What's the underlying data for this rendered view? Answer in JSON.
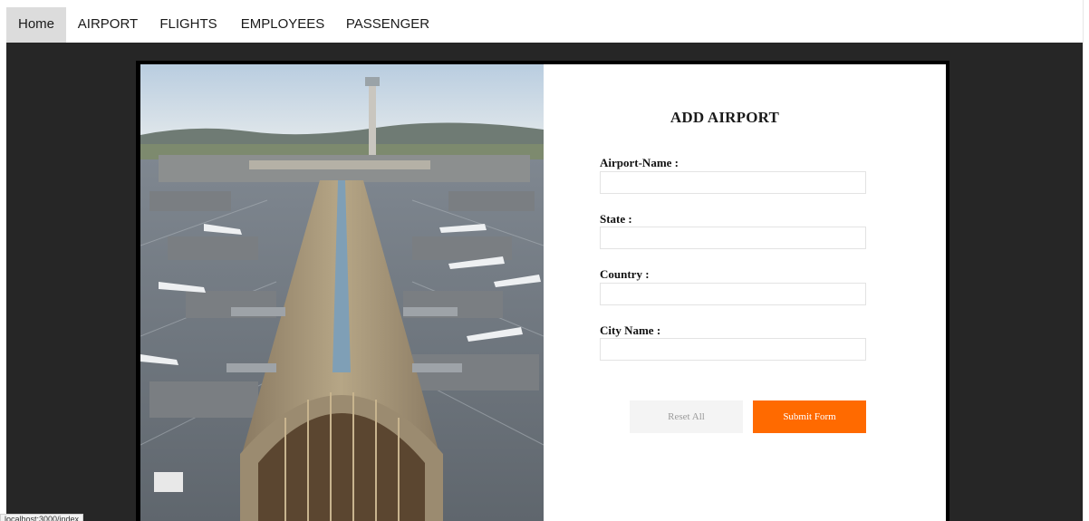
{
  "nav": {
    "items": [
      {
        "label": "Home",
        "active": true
      },
      {
        "label": "AIRPORT"
      },
      {
        "label": "FLIGHTS"
      },
      {
        "label": "EMPLOYEES"
      },
      {
        "label": "PASSENGER"
      }
    ]
  },
  "form": {
    "title": "ADD AIRPORT",
    "fields": [
      {
        "label": "Airport-Name :",
        "value": ""
      },
      {
        "label": "State :",
        "value": ""
      },
      {
        "label": "Country :",
        "value": ""
      },
      {
        "label": "City Name :",
        "value": ""
      }
    ],
    "reset_label": "Reset All",
    "submit_label": "Submit Form"
  },
  "status_bar": {
    "url": "localhost:3000/index"
  },
  "colors": {
    "accent": "#ff6a00",
    "page_background": "#262626",
    "active_nav": "#dcdcdc"
  }
}
